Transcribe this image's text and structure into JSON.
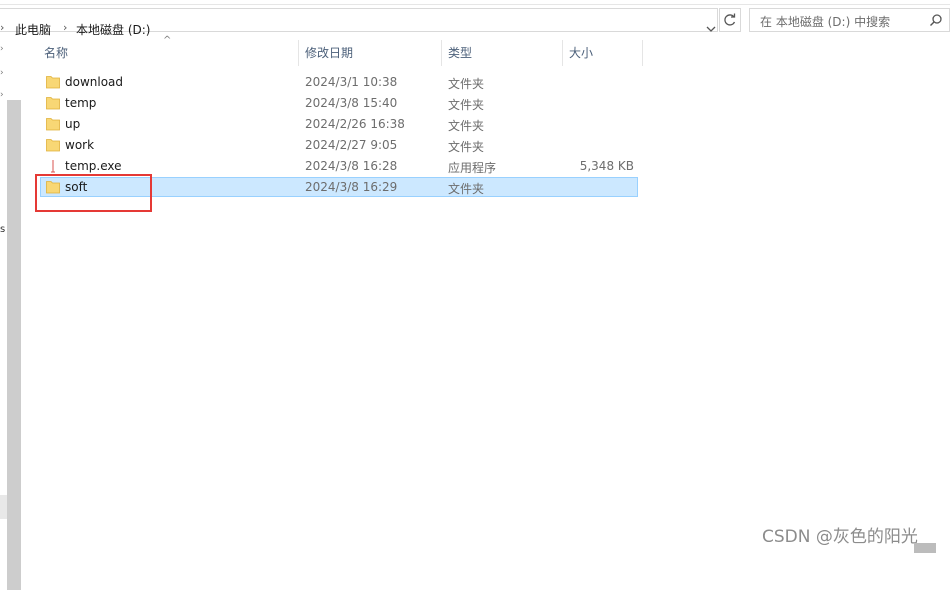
{
  "address_bar": {
    "crumbs": [
      "此电脑",
      "本地磁盘 (D:)"
    ]
  },
  "search": {
    "placeholder": "在 本地磁盘 (D:) 中搜索"
  },
  "columns": {
    "name": "名称",
    "date": "修改日期",
    "type": "类型",
    "size": "大小"
  },
  "files": [
    {
      "name": "download",
      "date": "2024/3/1 10:38",
      "type": "文件夹",
      "size": "",
      "icon": "folder-icon"
    },
    {
      "name": "temp",
      "date": "2024/3/8 15:40",
      "type": "文件夹",
      "size": "",
      "icon": "folder-icon"
    },
    {
      "name": "up",
      "date": "2024/2/26 16:38",
      "type": "文件夹",
      "size": "",
      "icon": "folder-icon"
    },
    {
      "name": "work",
      "date": "2024/2/27 9:05",
      "type": "文件夹",
      "size": "",
      "icon": "folder-icon"
    },
    {
      "name": "temp.exe",
      "date": "2024/3/8 16:28",
      "type": "应用程序",
      "size": "5,348 KB",
      "icon": "exe-icon"
    },
    {
      "name": "soft",
      "date": "2024/3/8 16:29",
      "type": "文件夹",
      "size": "",
      "icon": "folder-icon",
      "selected": true
    }
  ],
  "nav_fragment": "s",
  "watermark": "CSDN @灰色的阳光",
  "colors": {
    "selection_bg": "#cce8ff",
    "selection_border": "#99d1ff",
    "folder": "#f8d775",
    "annotation": "#e53935",
    "header_text": "#4c607a"
  }
}
